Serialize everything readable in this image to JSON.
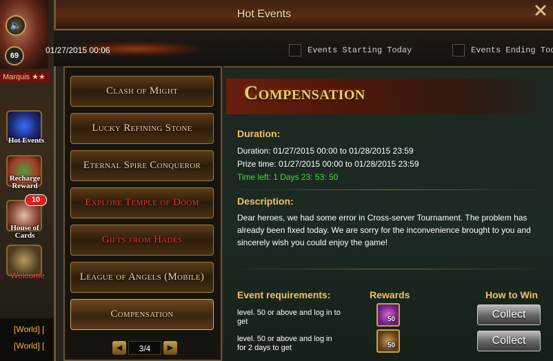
{
  "sidebar": {
    "level": "69",
    "rank": "Marquis ★★",
    "hot_events": "Hot Events",
    "recharge": "Recharge Reward",
    "house": "House of Cards",
    "house_badge": "10",
    "welcome": "Welcome",
    "chat": [
      "[World] [",
      "[World] ["
    ]
  },
  "window": {
    "title": "Hot Events",
    "current_date": "01/27/2015 00:06",
    "filter_starting": "Events Starting Today",
    "filter_ending": "Events Ending Tod"
  },
  "event_list": {
    "items": [
      {
        "label": "Clash of Might"
      },
      {
        "label": "Lucky Refining Stone"
      },
      {
        "label": "Eternal Spire Conqueror"
      },
      {
        "label": "Explore Temple of Doom"
      },
      {
        "label": "Gifts from Hades"
      },
      {
        "label": "League of Angels (Mobile)"
      },
      {
        "label": "Compensation"
      }
    ],
    "page": "3/4"
  },
  "detail": {
    "banner_title": "Compensation",
    "duration_head": "Duration:",
    "duration": "Duration: 01/27/2015 00:00 to 01/28/2015 23:59",
    "prize_time": "Prize time: 01/27/2015 00:00 to 01/28/2015 23:59",
    "time_left": "Time left: 1 Days  23: 53: 50",
    "description_head": "Description:",
    "description": "Dear heroes, we had some error in Cross-server Tournament. The problem has already been fixed today. We are sorry for the inconvenience brought to you and sincerely wish you could enjoy the game!",
    "requirements_head": "Event requirements:",
    "rewards_head": "Rewards",
    "how_to_win_head": "How to Win",
    "rows": [
      {
        "requirement": "level. 50 or above and log in to get",
        "reward_qty": "50",
        "action": "Collect"
      },
      {
        "requirement": "level. 50 or above and log in for 2 days to get",
        "reward_qty": "50",
        "action": "Collect"
      }
    ]
  },
  "colors": {
    "accent_gold": "#f2c36a",
    "time_left_green": "#3ee03e",
    "highlight_red": "#e23b2b"
  }
}
